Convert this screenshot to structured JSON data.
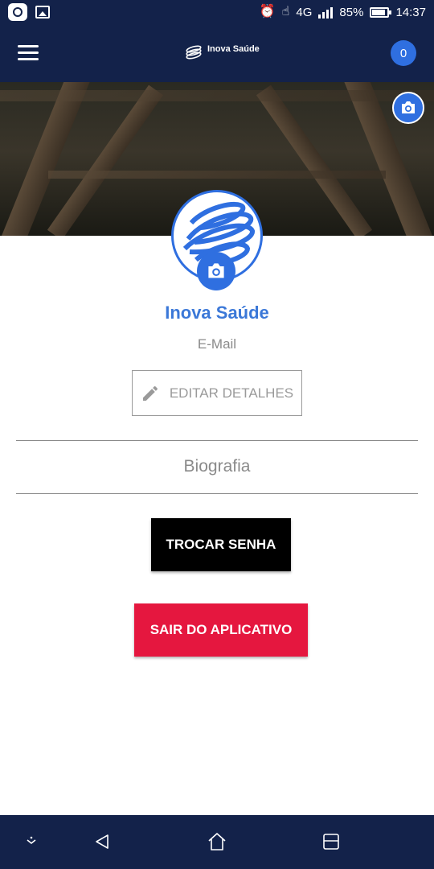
{
  "status_bar": {
    "battery": "85%",
    "time": "14:37",
    "network": "4G",
    "icons": [
      "app-notification-icon",
      "gallery-icon",
      "alarm-icon",
      "touch-icon",
      "network-4g-icon",
      "signal-icon",
      "battery-icon"
    ]
  },
  "app_bar": {
    "menu_icon": "hamburger-menu-icon",
    "logo_title": "Inova Saúde",
    "notification_count": "0"
  },
  "cover": {
    "camera_icon": "camera-icon"
  },
  "profile": {
    "name": "Inova Saúde",
    "email": "E-Mail",
    "edit_label": "EDITAR DETALHES",
    "edit_icon": "pencil-icon",
    "bio_placeholder": "Biografia"
  },
  "actions": {
    "change_password": "TROCAR SENHA",
    "exit_app": "SAIR DO APLICATIVO"
  },
  "nav_bar": {
    "icons": [
      "collapse-icon",
      "back-icon",
      "home-icon",
      "recents-icon"
    ]
  },
  "colors": {
    "primary_dark": "#13224a",
    "accent_blue": "#2f6fe0",
    "name_blue": "#3b78d8",
    "danger_red": "#e5173f"
  }
}
